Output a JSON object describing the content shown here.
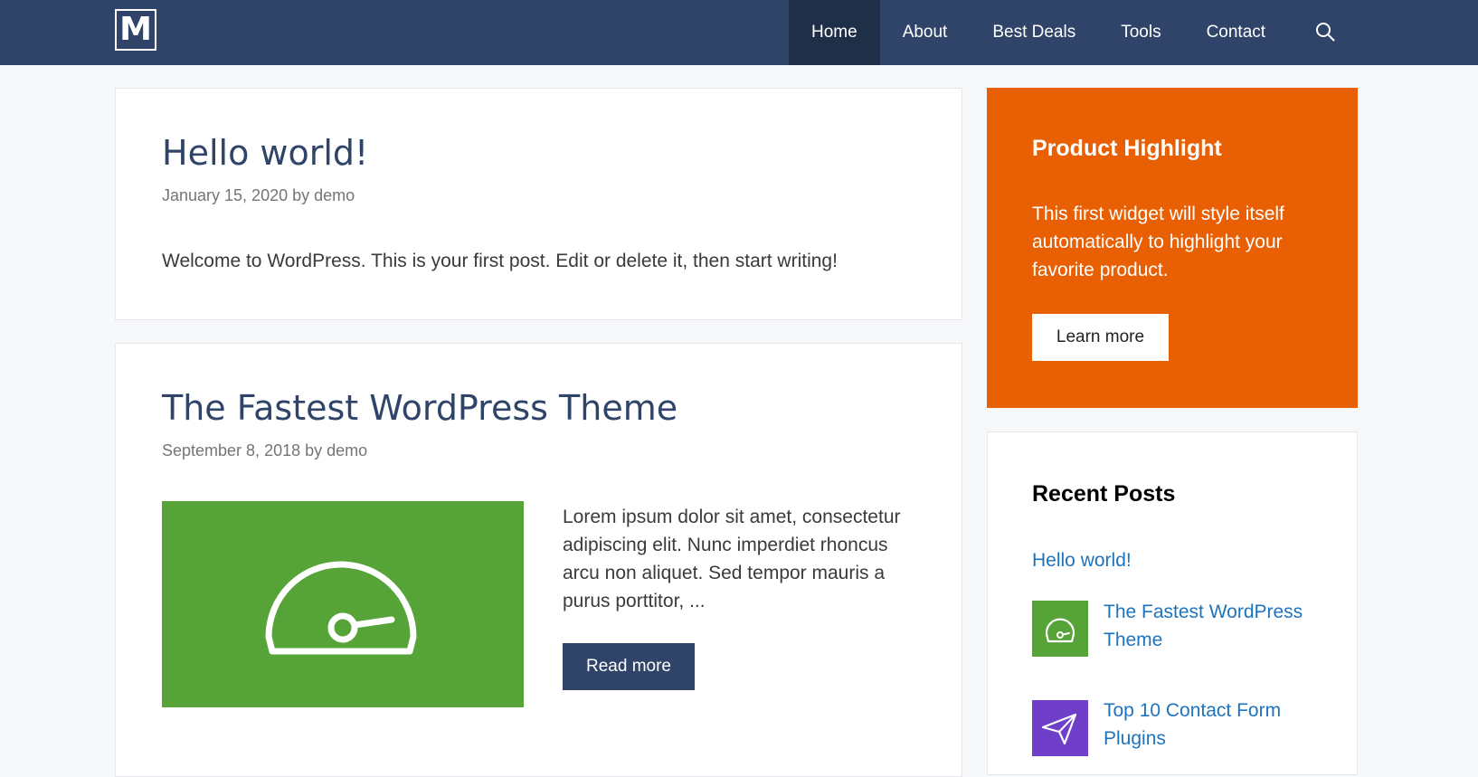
{
  "header": {
    "logo_letter": "M",
    "nav": [
      "Home",
      "About",
      "Best Deals",
      "Tools",
      "Contact"
    ],
    "active_index": 0,
    "brand_color": "#2f4468"
  },
  "posts": [
    {
      "title": "Hello world!",
      "date": "January 15, 2020",
      "by": "by",
      "author": "demo",
      "excerpt": "Welcome to WordPress. This is your first post. Edit or delete it, then start writing!"
    },
    {
      "title": "The Fastest WordPress Theme",
      "date": "September 8, 2018",
      "by": "by",
      "author": "demo",
      "excerpt": "Lorem ipsum dolor sit amet, consectetur adipiscing elit. Nunc imperdiet rhoncus arcu non aliquet. Sed tempor mauris a purus porttitor, ...",
      "thumbnail_icon": "speedometer-icon",
      "thumbnail_color": "#56a437",
      "read_more_label": "Read more"
    }
  ],
  "sidebar": {
    "highlight": {
      "title": "Product Highlight",
      "text": "This first widget will style itself automatically to highlight your favorite product.",
      "button_label": "Learn more",
      "color": "#e96004"
    },
    "recent_posts": {
      "title": "Recent Posts",
      "items": [
        {
          "label": "Hello world!"
        },
        {
          "label": "The Fastest WordPress Theme",
          "icon": "speedometer-icon",
          "color": "#56a437"
        },
        {
          "label": "Top 10 Contact Form Plugins",
          "icon": "paper-plane-icon",
          "color": "#6f3fc9"
        }
      ]
    }
  }
}
